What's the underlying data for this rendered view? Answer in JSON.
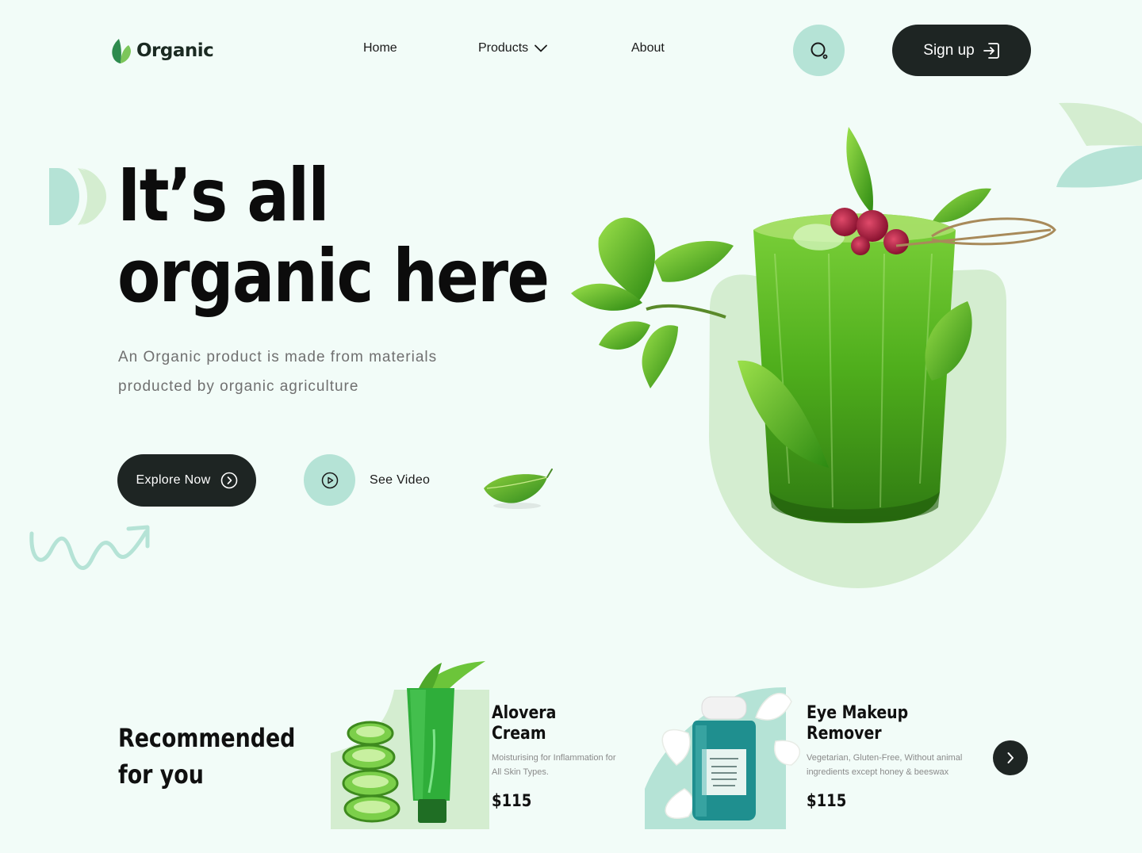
{
  "brand": {
    "name": "Organic"
  },
  "nav": {
    "home": "Home",
    "products": "Products",
    "about": "About"
  },
  "header": {
    "signup_label": "Sign up"
  },
  "icons": {
    "logo": "leaf-logo-icon",
    "search": "search-icon",
    "chevron": "chevron-down-icon",
    "signup": "sign-in-arrow-icon",
    "explore": "arrow-right-circle-icon",
    "play": "play-circle-icon",
    "next": "chevron-right-icon"
  },
  "hero": {
    "title_line1": "It’s all",
    "title_line2": "organic here",
    "description_line1": "An Organic product is made from materials",
    "description_line2": "producted by organic agriculture",
    "explore_label": "Explore Now",
    "video_label": "See Video"
  },
  "recommended": {
    "title_line1": "Recommended",
    "title_line2": "for you",
    "products": [
      {
        "name_line1": "Alovera",
        "name_line2": "Cream",
        "desc_line1": "Moisturising for Inflammation for",
        "desc_line2": "All Skin Types.",
        "price": "$115"
      },
      {
        "name_line1": "Eye Makeup",
        "name_line2": "Remover",
        "desc_line1": "Vegetarian, Gluten-Free, Without animal",
        "desc_line2": "ingredients except honey & beeswax",
        "price": "$115"
      }
    ]
  },
  "colors": {
    "background": "#f2fcf8",
    "mint": "#b5e3d6",
    "dark": "#1e2523",
    "leaf_green": "#2e8b2e"
  }
}
